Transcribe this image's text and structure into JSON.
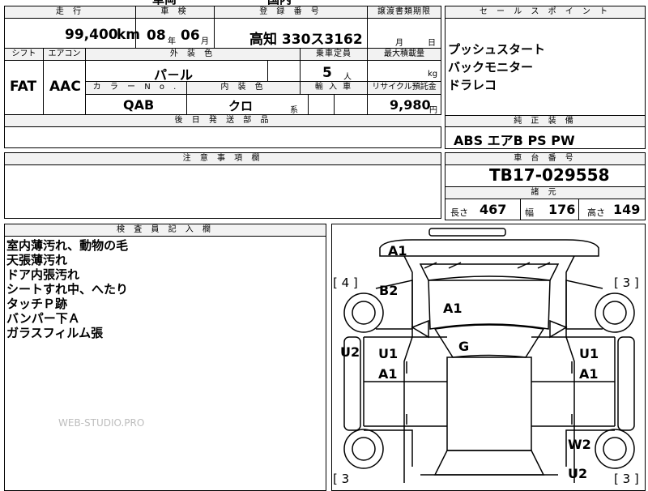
{
  "top_partial": {
    "left": "車両",
    "right": "国内"
  },
  "headers": {
    "mileage": "走 行",
    "inspection": "車 検",
    "registration": "登 録 番 号",
    "transfer": "譲渡書類期限",
    "sales_point": "セ ー ル ス ポ イ ン ト",
    "shift": "シフト",
    "aircon": "エアコン",
    "exterior_color": "外 装 色",
    "capacity": "乗車定員",
    "max_load": "最大積載量",
    "color_no": "カ ラ ー N o .",
    "interior_color": "内 装 色",
    "import": "輸 入 車",
    "recycle": "リサイクル預託金",
    "later_parts": "後 日 発 送 部 品",
    "genuine": "純 正 装 備",
    "caution": "注 意 事 項 欄",
    "chassis": "車 台 番 号",
    "specs": "諸 元",
    "inspector": "検 査 員 記 入 欄"
  },
  "values": {
    "mileage": "99,400",
    "mileage_unit": "km",
    "inspection_year": "08",
    "year_unit": "年",
    "inspection_month": "06",
    "month_unit": "月",
    "registration": "高知 330ス3162",
    "transfer_month_unit": "月",
    "transfer_day_unit": "日",
    "shift": "FAT",
    "aircon": "AAC",
    "exterior_color": "パ－ル",
    "capacity": "5",
    "capacity_unit": "人",
    "max_load_unit": "kg",
    "color_no": "QAB",
    "interior_color": "クロ",
    "interior_suffix": "系",
    "recycle": "9,980",
    "recycle_unit": "円",
    "chassis": "TB17-029558"
  },
  "sales_points": [
    "プッシュスタート",
    "バックモニター",
    "ドラレコ"
  ],
  "genuine_equipment": "ABS エアB PS PW",
  "specs": {
    "length_label": "長さ",
    "length": "467",
    "width_label": "幅",
    "width": "176",
    "height_label": "高さ",
    "height": "149"
  },
  "inspector_notes": [
    "室内薄汚れ、動物の毛",
    "天張薄汚れ",
    "ドア内張汚れ",
    "シートすれ中、へたり",
    "タッチＰ跡",
    "バンパー下Ａ",
    "ガラスフィルム張"
  ],
  "watermark": "WEB-STUDIO.PRO",
  "diagram_marks": {
    "a1_top": "A1",
    "b2": "B2",
    "a1_hood": "A1",
    "g": "G",
    "u2_left": "U2",
    "u1_left": "U1",
    "a1_left": "A1",
    "u1_right": "U1",
    "a1_right": "A1",
    "w2": "W2",
    "u2_bottom": "U2",
    "n4_left": "[ 4 ]",
    "n3_right": "[ 3 ]",
    "n3_bl": "[ 3",
    "n3_br": "[ 3 ]"
  }
}
